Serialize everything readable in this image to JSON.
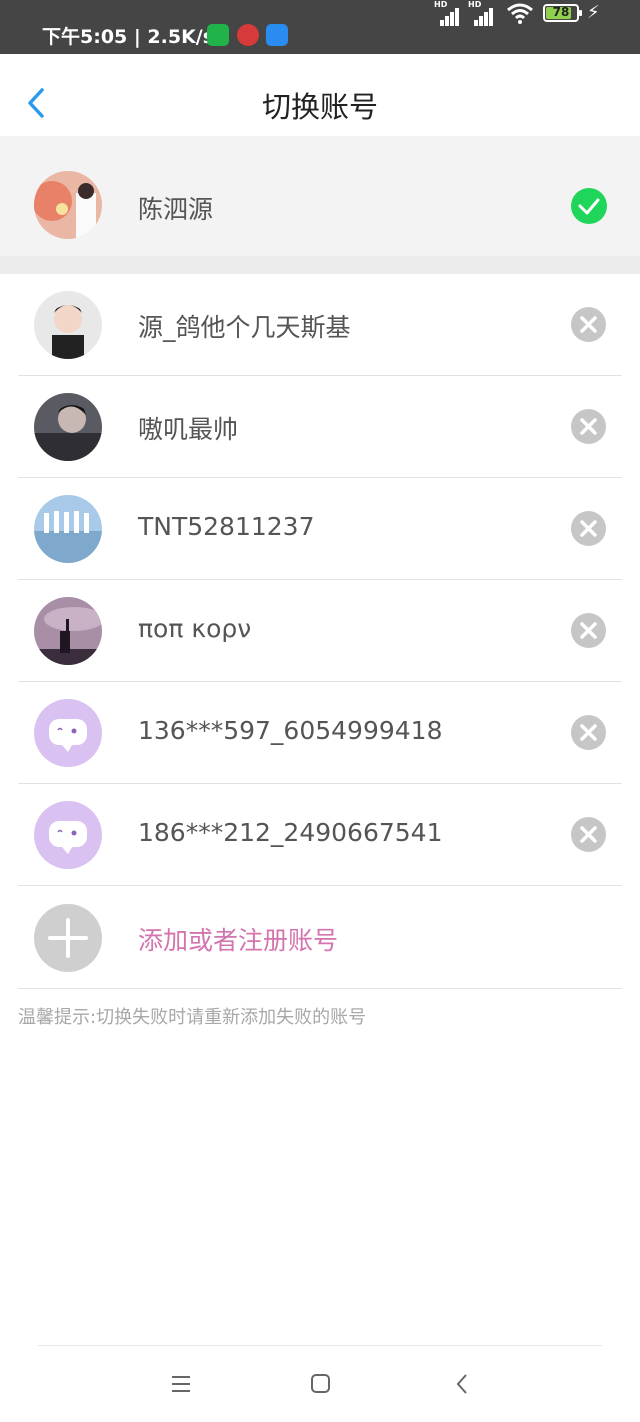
{
  "status_bar": {
    "time_speed": "下午5:05 | 2.5K/s",
    "battery": "78",
    "signal_label_1": "HD",
    "signal_label_2": "HD"
  },
  "header": {
    "title": "切换账号"
  },
  "current_account": {
    "name": "陈泗源"
  },
  "accounts": [
    {
      "name": "源_鸽他个几天斯基"
    },
    {
      "name": "嗷叽最帅"
    },
    {
      "name": "TNT52811237"
    },
    {
      "name": "ποπ κορν"
    },
    {
      "name": "136***597_6054999418"
    },
    {
      "name": "186***212_2490667541"
    }
  ],
  "add_account": {
    "label": "添加或者注册账号"
  },
  "tip": "温馨提示:切换失败时请重新添加失败的账号",
  "colors": {
    "accent_blue": "#2a9bea",
    "check_green": "#1fd65a",
    "add_pink": "#d374ae",
    "default_avatar": "#d9c2f2"
  }
}
